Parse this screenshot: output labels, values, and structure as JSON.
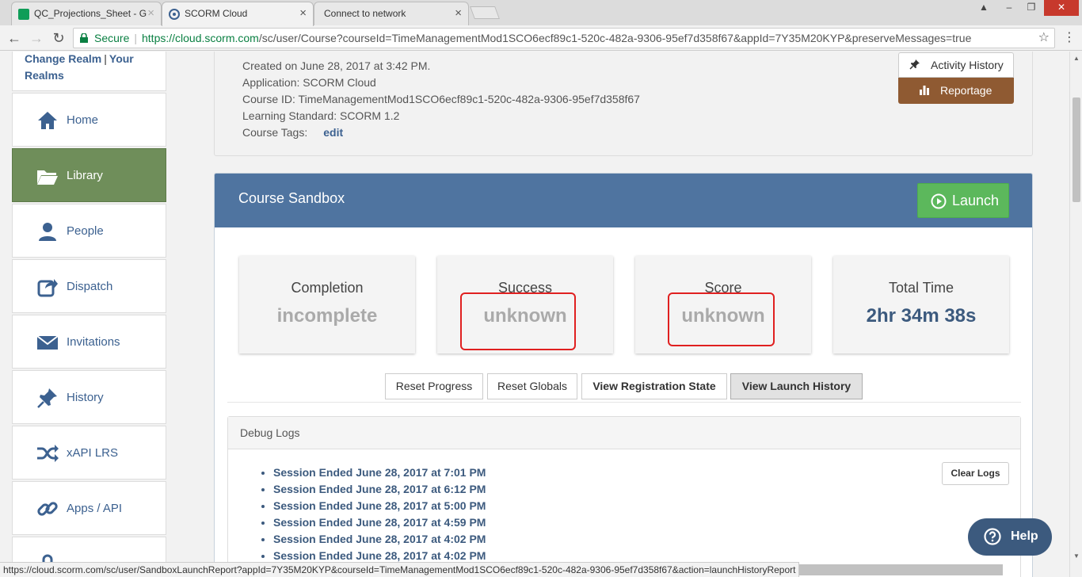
{
  "browser": {
    "tabs": [
      {
        "title": "QC_Projections_Sheet - G"
      },
      {
        "title": "SCORM Cloud"
      },
      {
        "title": "Connect to network"
      }
    ],
    "secure_label": "Secure",
    "url_host": "https://cloud.scorm.com",
    "url_path": "/sc/user/Course?courseId=TimeManagementMod1SCO6ecf89c1-520c-482a-9306-95ef7d358f67&appId=7Y35M20KYP&preserveMessages=true",
    "status_url": "https://cloud.scorm.com/sc/user/SandboxLaunchReport?appId=7Y35M20KYP&courseId=TimeManagementMod1SCO6ecf89c1-520c-482a-9306-95ef7d358f67&action=launchHistoryReport"
  },
  "sidebar": {
    "realm_link": "Change Realm",
    "realm_sep": "|",
    "your_realms_1": "Your",
    "your_realms_2": "Realms",
    "items": [
      {
        "label": "Home",
        "icon": "home-icon"
      },
      {
        "label": "Library",
        "icon": "folder-open-icon"
      },
      {
        "label": "People",
        "icon": "person-icon"
      },
      {
        "label": "Dispatch",
        "icon": "share-icon"
      },
      {
        "label": "Invitations",
        "icon": "envelope-icon"
      },
      {
        "label": "History",
        "icon": "pushpin-icon"
      },
      {
        "label": "xAPI LRS",
        "icon": "shuffle-icon"
      },
      {
        "label": "Apps / API",
        "icon": "link-icon"
      }
    ]
  },
  "course_info": {
    "created": "Created on June 28, 2017 at 3:42 PM.",
    "application": "Application: SCORM Cloud",
    "course_id": "Course ID: TimeManagementMod1SCO6ecf89c1-520c-482a-9306-95ef7d358f67",
    "standard": "Learning Standard: SCORM 1.2",
    "tags_label": "Course Tags:",
    "tags_edit": "edit",
    "activity_history": "Activity History",
    "reportage": "Reportage"
  },
  "sandbox": {
    "title": "Course Sandbox",
    "launch": "Launch",
    "stats": [
      {
        "label": "Completion",
        "value": "incomplete"
      },
      {
        "label": "Success",
        "value": "unknown"
      },
      {
        "label": "Score",
        "value": "unknown"
      },
      {
        "label": "Total Time",
        "value": "2hr 34m 38s"
      }
    ],
    "actions": {
      "reset_progress": "Reset Progress",
      "reset_globals": "Reset Globals",
      "view_registration": "View Registration State",
      "view_launch_history": "View Launch History"
    },
    "debug": {
      "title": "Debug Logs",
      "clear": "Clear Logs",
      "logs": [
        "Session Ended June 28, 2017 at 7:01 PM",
        "Session Ended June 28, 2017 at 6:12 PM",
        "Session Ended June 28, 2017 at 5:00 PM",
        "Session Ended June 28, 2017 at 4:59 PM",
        "Session Ended June 28, 2017 at 4:02 PM",
        "Session Ended June 28, 2017 at 4:02 PM"
      ]
    }
  },
  "help": {
    "label": "Help"
  },
  "colors": {
    "brand_blue": "#4f74a0",
    "link_blue": "#3c6190",
    "active_green": "#6f8e5a",
    "launch_green": "#5cb85c",
    "reportage_brown": "#8f5a32",
    "highlight_red": "#e02020"
  }
}
